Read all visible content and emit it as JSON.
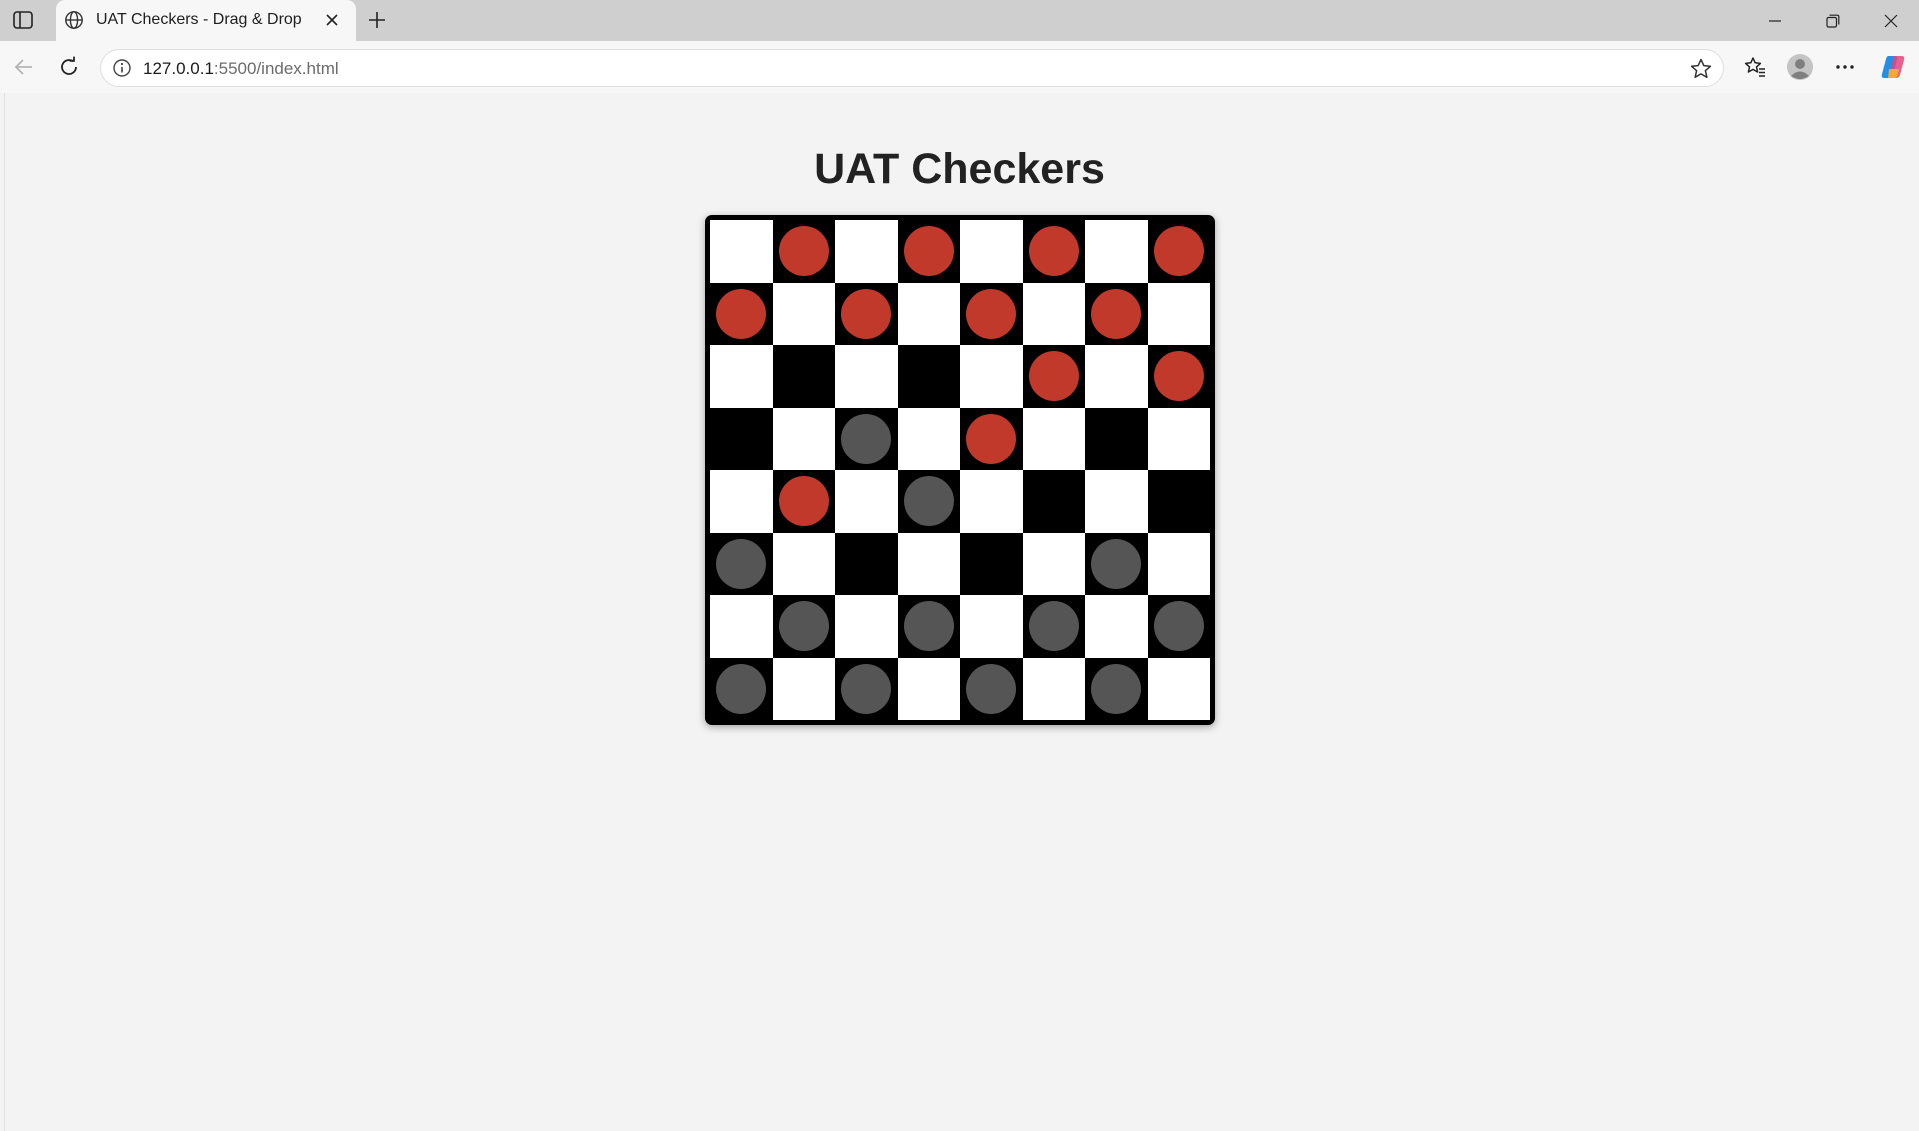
{
  "browser": {
    "tab_title": "UAT Checkers - Drag & Drop",
    "url_host": "127.0.0.1",
    "url_path": ":5500/index.html"
  },
  "page": {
    "title": "UAT Checkers"
  },
  "colors": {
    "light_square": "#ffffff",
    "dark_square": "#000000",
    "red_piece": "#c0392b",
    "black_piece": "#555555"
  },
  "board": {
    "rows": [
      "LrLrLrLr",
      "rLrLrLrL",
      "LDLDLrLr",
      "DLbLrLDL",
      "LrLbLDLD",
      "bLDLDLbL",
      "LbLbLbLb",
      "bLbLbLbL"
    ],
    "legend": {
      "L": "light square",
      "D": "dark square (empty)",
      "r": "red piece on dark square",
      "b": "black piece on dark square"
    }
  }
}
